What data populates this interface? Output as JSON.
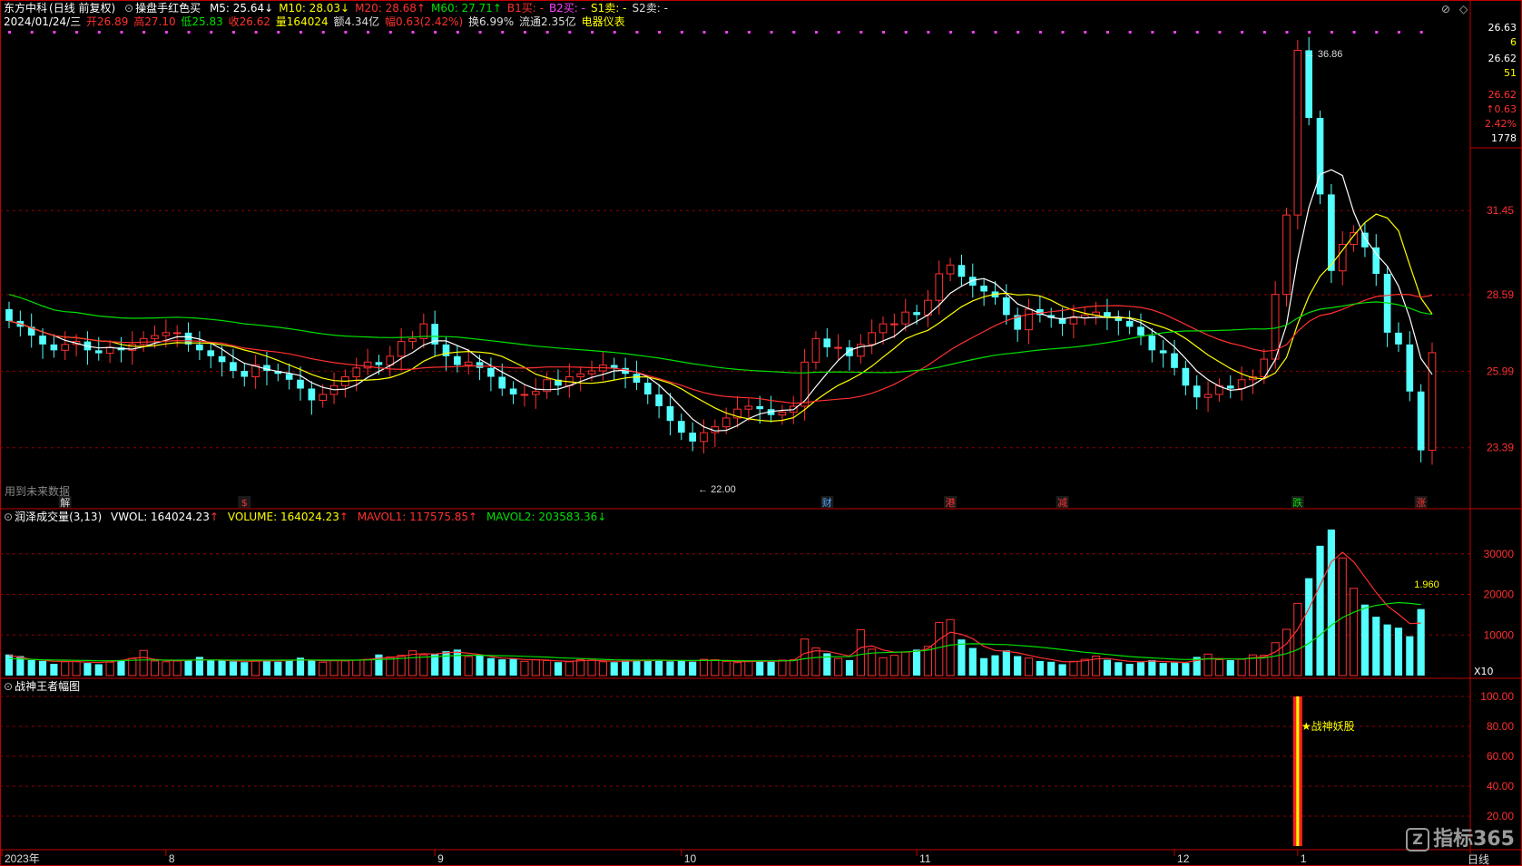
{
  "window": {
    "title_name": "东方中科",
    "title_mode": "(日线 前复权)",
    "indicator_name": "操盘手红色买",
    "ma": [
      {
        "label": "M5: 25.64",
        "arrow": "↓",
        "color": "#ffffff"
      },
      {
        "label": "M10: 28.03",
        "arrow": "↓",
        "color": "#ffff00"
      },
      {
        "label": "M20: 28.68",
        "arrow": "↑",
        "color": "#ff3030"
      },
      {
        "label": "M60: 27.71",
        "arrow": "↑",
        "color": "#00e000"
      },
      {
        "label": "B1买: -",
        "arrow": "",
        "color": "#ff3030"
      },
      {
        "label": "B2买: -",
        "arrow": "",
        "color": "#ff40ff"
      },
      {
        "label": "S1卖: -",
        "arrow": "",
        "color": "#ffff00"
      },
      {
        "label": "S2卖: -",
        "arrow": "",
        "color": "#dddddd"
      }
    ]
  },
  "quote_line": {
    "date": "2024/01/24/三",
    "open": "开26.89",
    "high": "高27.10",
    "low": "低25.83",
    "close": "收26.62",
    "volume": "量164024",
    "amount": "额4.34亿",
    "change": "幅0.63(2.42%)",
    "turnover": "换6.99%",
    "float": "流通2.35亿",
    "sector": "电器仪表"
  },
  "price_panel": {
    "right_axis": [
      "31.45",
      "28.59",
      "25.99",
      "23.39"
    ],
    "info_box": [
      "26.63",
      "6",
      "26.62",
      "51",
      "26.62",
      "↑0.63",
      "2.42%",
      "1778"
    ],
    "high_label": "36.86",
    "low_label": "22.00",
    "future_note": "用到未来数据",
    "event_markers": [
      "解",
      "$",
      "财",
      "港",
      "减",
      "跌",
      "涨"
    ]
  },
  "volume_panel": {
    "title": "润泽成交量(3,13)",
    "vwol": "VWOL: 164024.23",
    "vwol_arrow": "↑",
    "volume": "VOLUME: 164024.23",
    "volume_arrow": "↑",
    "mavol1": "MAVOL1: 117575.85",
    "mavol1_arrow": "↑",
    "mavol2": "MAVOL2: 203583.36",
    "mavol2_arrow": "↓",
    "right_axis": [
      "30000",
      "20000",
      "10000"
    ],
    "unit": "X10",
    "end_label": "1.960"
  },
  "war_panel": {
    "title": "战神王者幅图",
    "right_axis": [
      "100.00",
      "80.00",
      "60.00",
      "40.00",
      "20.00"
    ],
    "signal_label": "★战神妖股"
  },
  "time_axis": {
    "labels": [
      "2023年",
      "8",
      "9",
      "10",
      "11",
      "12",
      "1"
    ],
    "period": "日线"
  },
  "watermark": {
    "text": "指标365",
    "logo": "Z"
  },
  "window_buttons": [
    "⊘",
    "◇"
  ],
  "chart_data": {
    "type": "candlestick",
    "series": [
      {
        "name": "close",
        "values": [
          27.7,
          27.5,
          27.2,
          26.9,
          26.7,
          26.9,
          27.0,
          26.7,
          26.6,
          26.8,
          26.7,
          26.9,
          27.1,
          27.2,
          27.3,
          27.3,
          26.9,
          26.7,
          26.5,
          26.3,
          26.0,
          25.8,
          26.2,
          26.0,
          25.9,
          25.7,
          25.4,
          25.0,
          25.2,
          25.5,
          25.8,
          26.1,
          26.3,
          26.2,
          26.5,
          27.0,
          27.1,
          27.6,
          26.9,
          26.5,
          26.2,
          26.3,
          26.1,
          25.8,
          25.4,
          25.2,
          25.2,
          25.3,
          25.7,
          25.5,
          25.8,
          25.9,
          26.0,
          26.2,
          26.1,
          25.9,
          25.6,
          25.2,
          24.8,
          24.3,
          23.9,
          23.6,
          23.9,
          24.1,
          24.4,
          24.7,
          24.8,
          24.7,
          24.5,
          24.6,
          24.8,
          26.3,
          27.1,
          26.8,
          26.8,
          26.5,
          26.9,
          27.3,
          27.6,
          27.6,
          28.0,
          27.9,
          28.4,
          29.3,
          29.6,
          29.2,
          28.9,
          28.7,
          28.5,
          27.9,
          27.4,
          28.1,
          27.9,
          27.8,
          27.6,
          27.8,
          27.9,
          28.0,
          27.8,
          27.7,
          27.5,
          27.2,
          26.7,
          26.6,
          26.1,
          25.5,
          25.1,
          25.2,
          25.5,
          25.4,
          25.7,
          25.8,
          26.4,
          28.6,
          31.3,
          36.9,
          34.6,
          32.0,
          29.4,
          30.3,
          30.7,
          30.2,
          29.3,
          27.3,
          26.9,
          25.3,
          23.3,
          26.62
        ]
      },
      {
        "name": "volume",
        "values": [
          5200,
          4800,
          3800,
          3600,
          2900,
          3400,
          3500,
          3100,
          2800,
          3300,
          3600,
          4200,
          6200,
          3600,
          3400,
          3600,
          3800,
          4600,
          3800,
          3900,
          3500,
          3300,
          3600,
          3800,
          3400,
          3900,
          4400,
          3700,
          3300,
          3700,
          3600,
          3800,
          4000,
          5200,
          4600,
          5000,
          6100,
          5100,
          5400,
          6000,
          6400,
          4700,
          5000,
          4300,
          4000,
          4100,
          3500,
          3900,
          3700,
          3300,
          3400,
          3900,
          3800,
          3400,
          3300,
          3700,
          3800,
          3600,
          3900,
          3500,
          3800,
          3400,
          4000,
          3900,
          3500,
          3200,
          3500,
          3700,
          3400,
          3800,
          3900,
          9000,
          6800,
          5500,
          4200,
          3800,
          11300,
          6500,
          4400,
          5000,
          5800,
          6400,
          7200,
          13100,
          13800,
          8900,
          6800,
          4300,
          5000,
          6200,
          4800,
          4300,
          3600,
          3400,
          2800,
          3500,
          4000,
          4800,
          3900,
          3300,
          2900,
          3300,
          3800,
          3100,
          3200,
          3100,
          4600,
          5300,
          3900,
          3800,
          4000,
          5100,
          5000,
          8100,
          11400,
          17800,
          24000,
          32000,
          36000,
          29000,
          21500,
          17500,
          14500,
          12600,
          11800,
          9700,
          16400
        ]
      },
      {
        "name": "MAVOL1",
        "values": [
          5000,
          4500,
          4000,
          3800,
          3500,
          3500,
          3450,
          3300,
          3250,
          3400,
          3700,
          4300,
          4500,
          4000,
          3700,
          3600,
          3750,
          3900,
          3850,
          3800,
          3650,
          3500,
          3550,
          3650,
          3600,
          3700,
          3850,
          3800,
          3650,
          3650,
          3700,
          3800,
          3950,
          4300,
          4400,
          4700,
          5200,
          5400,
          5300,
          5600,
          5800,
          5500,
          5200,
          4700,
          4300,
          4200,
          3950,
          3900,
          3800,
          3600,
          3500,
          3650,
          3750,
          3650,
          3500,
          3550,
          3650,
          3650,
          3750,
          3650,
          3700,
          3600,
          3750,
          3800,
          3650,
          3450,
          3450,
          3550,
          3500,
          3600,
          3750,
          5500,
          6100,
          6000,
          5400,
          4800,
          6900,
          7300,
          6300,
          5800,
          5800,
          6000,
          6600,
          8900,
          10700,
          10200,
          9100,
          7200,
          6200,
          6000,
          5600,
          5000,
          4400,
          3950,
          3450,
          3400,
          3650,
          4100,
          4200,
          3850,
          3500,
          3400,
          3600,
          3450,
          3350,
          3250,
          3700,
          4200,
          4200,
          4100,
          4050,
          4400,
          4600,
          5800,
          7800,
          11400,
          16500,
          22300,
          28000,
          30400,
          28000,
          24300,
          20500,
          17200,
          15100,
          12800,
          12950
        ]
      },
      {
        "name": "MAVOL2",
        "values": [
          4200,
          4100,
          4000,
          3900,
          3850,
          3800,
          3750,
          3700,
          3650,
          3650,
          3700,
          3750,
          3850,
          3850,
          3800,
          3800,
          3800,
          3850,
          3850,
          3850,
          3800,
          3800,
          3800,
          3800,
          3800,
          3800,
          3850,
          3850,
          3800,
          3800,
          3800,
          3800,
          3850,
          3950,
          4050,
          4200,
          4400,
          4550,
          4650,
          4800,
          4950,
          5000,
          5000,
          4950,
          4900,
          4850,
          4750,
          4650,
          4550,
          4400,
          4300,
          4200,
          4100,
          4000,
          3900,
          3850,
          3800,
          3800,
          3800,
          3750,
          3700,
          3700,
          3700,
          3700,
          3700,
          3650,
          3650,
          3650,
          3650,
          3650,
          3650,
          4150,
          4450,
          4600,
          4650,
          4650,
          5200,
          5550,
          5650,
          5750,
          5850,
          6000,
          6250,
          6900,
          7500,
          7750,
          7850,
          7800,
          7700,
          7650,
          7450,
          7250,
          7000,
          6700,
          6400,
          6050,
          5750,
          5500,
          5200,
          4950,
          4700,
          4500,
          4350,
          4200,
          4050,
          3950,
          4000,
          4100,
          4100,
          4100,
          4100,
          4250,
          4350,
          4800,
          5400,
          6400,
          7950,
          10000,
          12400,
          14300,
          15600,
          16600,
          17300,
          17700,
          18000,
          17800,
          17500
        ]
      }
    ],
    "xlabel": "",
    "ylabel": "",
    "ylim": [
      21.5,
      37.5
    ],
    "volume_ylim": [
      0,
      38000
    ],
    "war_ylim": [
      0,
      100
    ]
  }
}
